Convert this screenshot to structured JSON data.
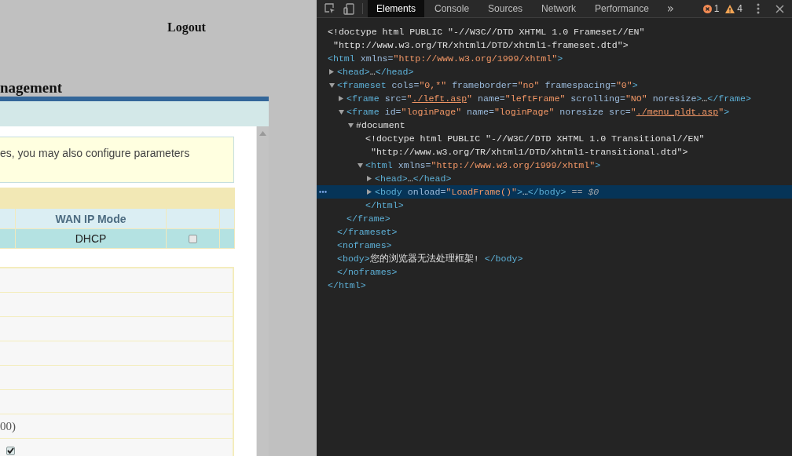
{
  "page": {
    "logout": "Logout",
    "heading": "nagement",
    "note": "es, you may also configure parameters",
    "table": {
      "columns": [
        {
          "label": "WAN IP Mode"
        }
      ],
      "rows": [
        {
          "cells": [
            "DHCP"
          ],
          "checked": false
        }
      ]
    },
    "form_rows": [
      {
        "kind": "blank"
      },
      {
        "kind": "blank"
      },
      {
        "kind": "blank"
      },
      {
        "kind": "blank"
      },
      {
        "kind": "blank"
      },
      {
        "kind": "blank"
      },
      {
        "kind": "text",
        "text": "00)"
      },
      {
        "kind": "checkbox",
        "checked": true
      }
    ]
  },
  "devtools": {
    "tabs": [
      {
        "label": "Elements",
        "selected": true
      },
      {
        "label": "Console",
        "selected": false
      },
      {
        "label": "Sources",
        "selected": false
      },
      {
        "label": "Network",
        "selected": false
      },
      {
        "label": "Performance",
        "selected": false
      }
    ],
    "more_tabs": "»",
    "errors": "1",
    "warnings": "4",
    "tree": [
      {
        "selected": false,
        "lines": [
          [
            {
              "kind": "text",
              "t": "<!doctype html PUBLIC \"-//W3C//DTD XHTML 1.0 Frameset//EN\""
            }
          ],
          [
            {
              "kind": "text",
              "t": " \"http://www.w3.org/TR/xhtml1/DTD/xhtml1-frameset.dtd\">"
            }
          ]
        ]
      },
      {
        "selected": false,
        "lines": [
          [
            {
              "kind": "tag",
              "t": "<html"
            },
            {
              "kind": "attr",
              "t": " xmlns="
            },
            {
              "kind": "value",
              "t": "\"http://www.w3.org/1999/xhtml\""
            },
            {
              "kind": "tag",
              "t": ">"
            }
          ]
        ],
        "closing": [
          {
            "kind": "tag",
            "t": "</html>"
          }
        ],
        "children": [
          {
            "expanded": false,
            "selected": false,
            "lines": [
              [
                {
                  "kind": "tag",
                  "t": "<head>"
                },
                {
                  "kind": "text",
                  "t": "…"
                },
                {
                  "kind": "tag",
                  "t": "</head>"
                }
              ]
            ]
          },
          {
            "expanded": true,
            "selected": false,
            "lines": [
              [
                {
                  "kind": "tag",
                  "t": "<frameset"
                },
                {
                  "kind": "attr",
                  "t": " cols="
                },
                {
                  "kind": "value",
                  "t": "\"0,*\""
                },
                {
                  "kind": "attr",
                  "t": " frameborder="
                },
                {
                  "kind": "value",
                  "t": "\"no\""
                },
                {
                  "kind": "attr",
                  "t": " framespacing="
                },
                {
                  "kind": "value",
                  "t": "\"0\""
                },
                {
                  "kind": "tag",
                  "t": ">"
                }
              ]
            ],
            "closing": [
              {
                "kind": "tag",
                "t": "</frameset>"
              }
            ],
            "children": [
              {
                "expanded": false,
                "selected": false,
                "lines": [
                  [
                    {
                      "kind": "tag",
                      "t": "<frame"
                    },
                    {
                      "kind": "attr",
                      "t": " src="
                    },
                    {
                      "kind": "value",
                      "t": "\""
                    },
                    {
                      "kind": "link",
                      "t": "./left.asp"
                    },
                    {
                      "kind": "value",
                      "t": "\""
                    },
                    {
                      "kind": "attr",
                      "t": " name="
                    },
                    {
                      "kind": "value",
                      "t": "\"leftFrame\""
                    },
                    {
                      "kind": "attr",
                      "t": " scrolling="
                    },
                    {
                      "kind": "value",
                      "t": "\"NO\""
                    },
                    {
                      "kind": "attr",
                      "t": " noresize"
                    },
                    {
                      "kind": "tag",
                      "t": ">"
                    },
                    {
                      "kind": "text",
                      "t": "…"
                    },
                    {
                      "kind": "tag",
                      "t": "</frame>"
                    }
                  ]
                ]
              },
              {
                "expanded": true,
                "selected": false,
                "lines": [
                  [
                    {
                      "kind": "tag",
                      "t": "<frame"
                    },
                    {
                      "kind": "attr",
                      "t": " id="
                    },
                    {
                      "kind": "value",
                      "t": "\"loginPage\""
                    },
                    {
                      "kind": "attr",
                      "t": " name="
                    },
                    {
                      "kind": "value",
                      "t": "\"loginPage\""
                    },
                    {
                      "kind": "attr",
                      "t": " noresize src="
                    },
                    {
                      "kind": "value",
                      "t": "\""
                    },
                    {
                      "kind": "link",
                      "t": "./menu_pldt.asp"
                    },
                    {
                      "kind": "value",
                      "t": "\""
                    },
                    {
                      "kind": "tag",
                      "t": ">"
                    }
                  ]
                ],
                "closing": [
                  {
                    "kind": "tag",
                    "t": "</frame>"
                  }
                ],
                "children": [
                  {
                    "expanded": true,
                    "selected": false,
                    "lines": [
                      [
                        {
                          "kind": "text",
                          "t": "#document"
                        }
                      ]
                    ],
                    "children": [
                      {
                        "selected": false,
                        "lines": [
                          [
                            {
                              "kind": "text",
                              "t": "<!doctype html PUBLIC \"-//W3C//DTD XHTML 1.0 Transitional//EN\""
                            }
                          ],
                          [
                            {
                              "kind": "text",
                              "t": " \"http://www.w3.org/TR/xhtml1/DTD/xhtml1-transitional.dtd\">"
                            }
                          ]
                        ]
                      },
                      {
                        "expanded": true,
                        "selected": false,
                        "lines": [
                          [
                            {
                              "kind": "tag",
                              "t": "<html"
                            },
                            {
                              "kind": "attr",
                              "t": " xmlns="
                            },
                            {
                              "kind": "value",
                              "t": "\"http://www.w3.org/1999/xhtml\""
                            },
                            {
                              "kind": "tag",
                              "t": ">"
                            }
                          ]
                        ],
                        "closing": [
                          {
                            "kind": "tag",
                            "t": "</html>"
                          }
                        ],
                        "children": [
                          {
                            "expanded": false,
                            "selected": false,
                            "lines": [
                              [
                                {
                                  "kind": "tag",
                                  "t": "<head>"
                                },
                                {
                                  "kind": "text",
                                  "t": "…"
                                },
                                {
                                  "kind": "tag",
                                  "t": "</head>"
                                }
                              ]
                            ]
                          },
                          {
                            "expanded": false,
                            "selected": true,
                            "lines": [
                              [
                                {
                                  "kind": "tag",
                                  "t": "<body"
                                },
                                {
                                  "kind": "attr",
                                  "t": " onload="
                                },
                                {
                                  "kind": "value",
                                  "t": "\"LoadFrame()\""
                                },
                                {
                                  "kind": "tag",
                                  "t": ">"
                                },
                                {
                                  "kind": "text",
                                  "t": "…"
                                },
                                {
                                  "kind": "tag",
                                  "t": "</body>"
                                },
                                {
                                  "kind": "dim",
                                  "t": " == $0"
                                }
                              ]
                            ]
                          }
                        ]
                      }
                    ]
                  }
                ]
              }
            ]
          },
          {
            "selected": false,
            "lines": [
              [
                {
                  "kind": "tag",
                  "t": "<noframes>"
                }
              ]
            ]
          },
          {
            "selected": false,
            "lines": [
              [
                {
                  "kind": "tag",
                  "t": "<body>"
                },
                {
                  "kind": "text",
                  "t": "您的浏览器无法处理框架! "
                },
                {
                  "kind": "tag",
                  "t": "</body>"
                }
              ]
            ]
          },
          {
            "selected": false,
            "lines": [
              [
                {
                  "kind": "tag",
                  "t": "</noframes>"
                }
              ]
            ]
          }
        ]
      }
    ]
  }
}
